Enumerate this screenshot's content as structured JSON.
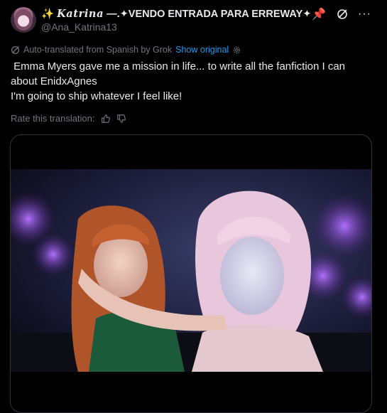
{
  "author": {
    "display_prefix": "✨ ",
    "display_script": "𝑲𝒂𝒕𝒓𝒊𝒏𝒂",
    "display_rest": " —.✦VENDO ENTRADA PARA ERREWAY✦",
    "pin_emoji": "📌",
    "handle": "@Ana_Katrina13"
  },
  "translation": {
    "label": "Auto-translated from Spanish by Grok",
    "show_original": "Show original",
    "rate_label": "Rate this translation:"
  },
  "tweet": {
    "lines": [
      " Emma Myers gave me a mission in life... to write all the fanfiction I can about EnidxAgnes",
      "I'm going to ship whatever I feel like!"
    ]
  },
  "icons": {
    "top_right": [
      "grok-icon",
      "more-icon"
    ],
    "translation": [
      "grok-icon",
      "gear-icon"
    ],
    "rate": [
      "thumbs-up-icon",
      "thumbs-down-icon"
    ]
  },
  "colors": {
    "background": "#000000",
    "text": "#e7e9ea",
    "muted": "#71767b",
    "link": "#1d9bf0",
    "border": "#2f3336"
  }
}
